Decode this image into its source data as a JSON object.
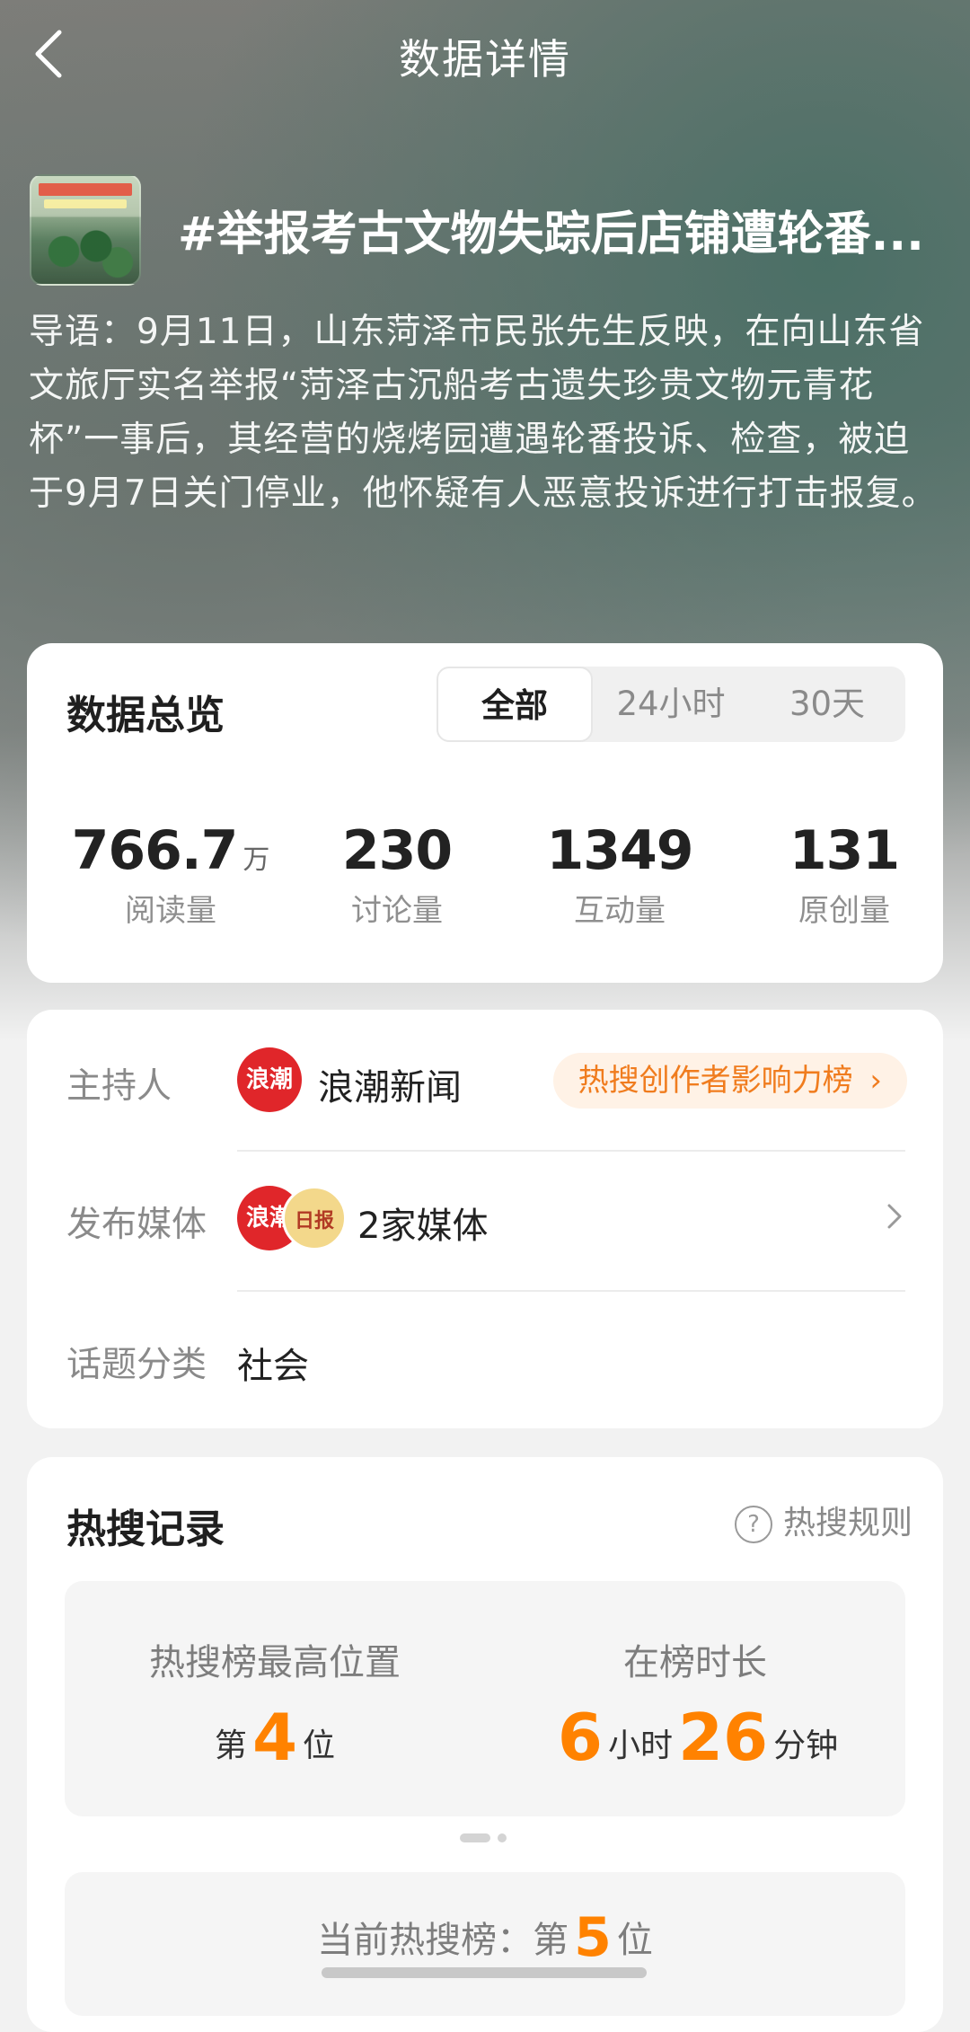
{
  "header": {
    "title": "数据详情"
  },
  "topic": {
    "title": "#举报考古文物失踪后店铺遭轮番...",
    "intro": "导语：9月11日，山东菏泽市民张先生反映，在向山东省文旅厅实名举报“菏泽古沉船考古遗失珍贵文物元青花杯”一事后，其经营的烧烤园遭遇轮番投诉、检查，被迫于9月7日关门停业，他怀疑有人恶意投诉进行打击报复。"
  },
  "overview": {
    "heading": "数据总览",
    "tabs": [
      {
        "label": "全部",
        "active": true
      },
      {
        "label": "24小时",
        "active": false
      },
      {
        "label": "30天",
        "active": false
      }
    ],
    "stats": [
      {
        "value": "766.7",
        "unit": "万",
        "label": "阅读量"
      },
      {
        "value": "230",
        "unit": "",
        "label": "讨论量"
      },
      {
        "value": "1349",
        "unit": "",
        "label": "互动量"
      },
      {
        "value": "131",
        "unit": "",
        "label": "原创量"
      }
    ]
  },
  "info": {
    "host_label": "主持人",
    "host_name": "浪潮新闻",
    "host_logo_text": "浪潮",
    "host_badge": "热搜创作者影响力榜",
    "media_label": "发布媒体",
    "media_count": "2家媒体",
    "media_logo2_text": "日报",
    "category_label": "话题分类",
    "category_value": "社会"
  },
  "record": {
    "heading": "热搜记录",
    "rules_link": "热搜规则",
    "best_position_label": "热搜榜最高位置",
    "best_position_prefix": "第",
    "best_position_value": "4",
    "best_position_suffix": "位",
    "duration_label": "在榜时长",
    "duration_hours": "6",
    "duration_hours_unit": "小时",
    "duration_minutes": "26",
    "duration_minutes_unit": "分钟",
    "current_label": "当前热搜榜：第",
    "current_value": "5",
    "current_suffix": "位"
  },
  "colors": {
    "accent": "#ff8200",
    "badge_bg": "#fff2e6",
    "logo_red": "#e0262a"
  }
}
